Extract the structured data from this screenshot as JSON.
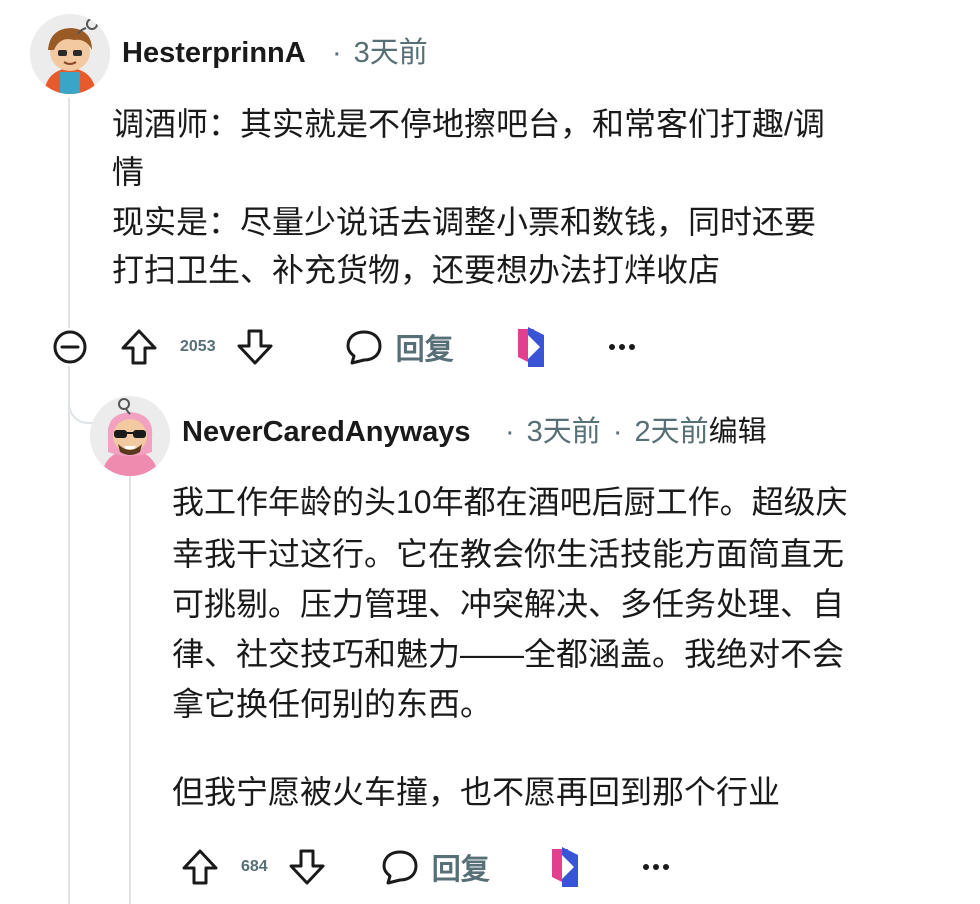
{
  "comment1": {
    "username": "HesterprinnA",
    "time": "3天前",
    "body_lines": [
      "调酒师：其实就是不停地擦吧台，和常客们打趣/调",
      "情",
      "现实是：尽量少说话去调整小票和数钱，同时还要",
      "打扫卫生、补充货物，还要想办法打烊收店"
    ],
    "votes": "2053",
    "reply_label": "回复"
  },
  "comment2": {
    "username": "NeverCaredAnyways",
    "time": "3天前",
    "edited_time": "2天前",
    "edited_label": "编辑",
    "body_lines": [
      "我工作年龄的头10年都在酒吧后厨工作。超级庆",
      "幸我干过这行。它在教会你生活技能方面简直无",
      "可挑剔。压力管理、冲突解决、多任务处理、自",
      "律、社交技巧和魅力——全都涵盖。我绝对不会",
      "拿它换任何别的东西。",
      "",
      "但我宁愿被火车撞，也不愿再回到那个行业"
    ],
    "votes": "684",
    "reply_label": "回复"
  },
  "colors": {
    "meta": "#576f76",
    "thread_line": "#dfe3e6",
    "award_pink": "#e2408f",
    "award_blue": "#3a54d6"
  },
  "icons": [
    "collapse-icon",
    "upvote-icon",
    "downvote-icon",
    "reply-icon",
    "award-icon",
    "more-icon"
  ]
}
